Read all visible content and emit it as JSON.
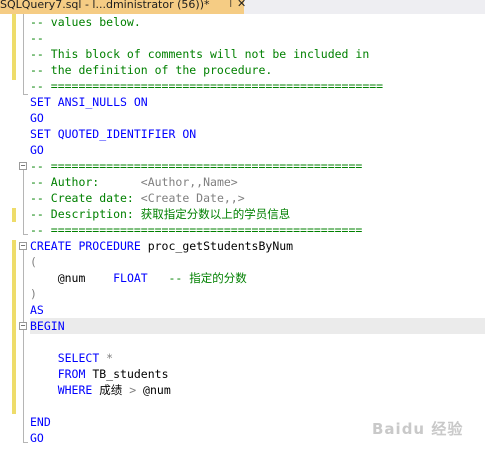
{
  "tab": {
    "title": "SQLQuery7.sql - l...dministrator (56))*",
    "pin_icon": "pin-icon",
    "close_icon": "close-icon"
  },
  "code": {
    "l1": "-- values below.",
    "l2": "--",
    "l3": "-- This block of comments will not be included in",
    "l4": "-- the definition of the procedure.",
    "l5": "-- ================================================",
    "l6_kw": "SET ANSI_NULLS ON",
    "l7_kw": "GO",
    "l8_kw": "SET QUOTED_IDENTIFIER ON",
    "l9_kw": "GO",
    "l10": "-- =============================================",
    "l11_a": "-- Author:      ",
    "l11_b": "<Author,,Name>",
    "l12_a": "-- Create date: ",
    "l12_b": "<Create Date,,>",
    "l13": "-- Description: 获取指定分数以上的学员信息",
    "l14": "-- =============================================",
    "l15_kw": "CREATE PROCEDURE",
    "l15_name": " proc_getStudentsByNum",
    "l16": "(",
    "l17_var": "    @num    ",
    "l17_kw": "FLOAT",
    "l17_cm": "   -- 指定的分数",
    "l18": ")",
    "l19_kw": "AS",
    "l20_kw": "BEGIN",
    "l21": "",
    "l22_ind": "    ",
    "l22_kw": "SELECT",
    "l22_rest": " *",
    "l23_ind": "    ",
    "l23_kw": "FROM",
    "l23_rest": " TB_students",
    "l24_ind": "    ",
    "l24_kw": "WHERE",
    "l24_rest": " 成绩 ",
    "l24_op": ">",
    "l24_var": " @num",
    "l25": "",
    "l26_kw": "END",
    "l27_kw": "GO"
  },
  "watermark": "Baidu 经验",
  "colors": {
    "keyword": "#0000ff",
    "comment": "#008000",
    "operator": "#808080",
    "tab_active": "#f5cc84",
    "change_marker": "#eedc6a"
  }
}
